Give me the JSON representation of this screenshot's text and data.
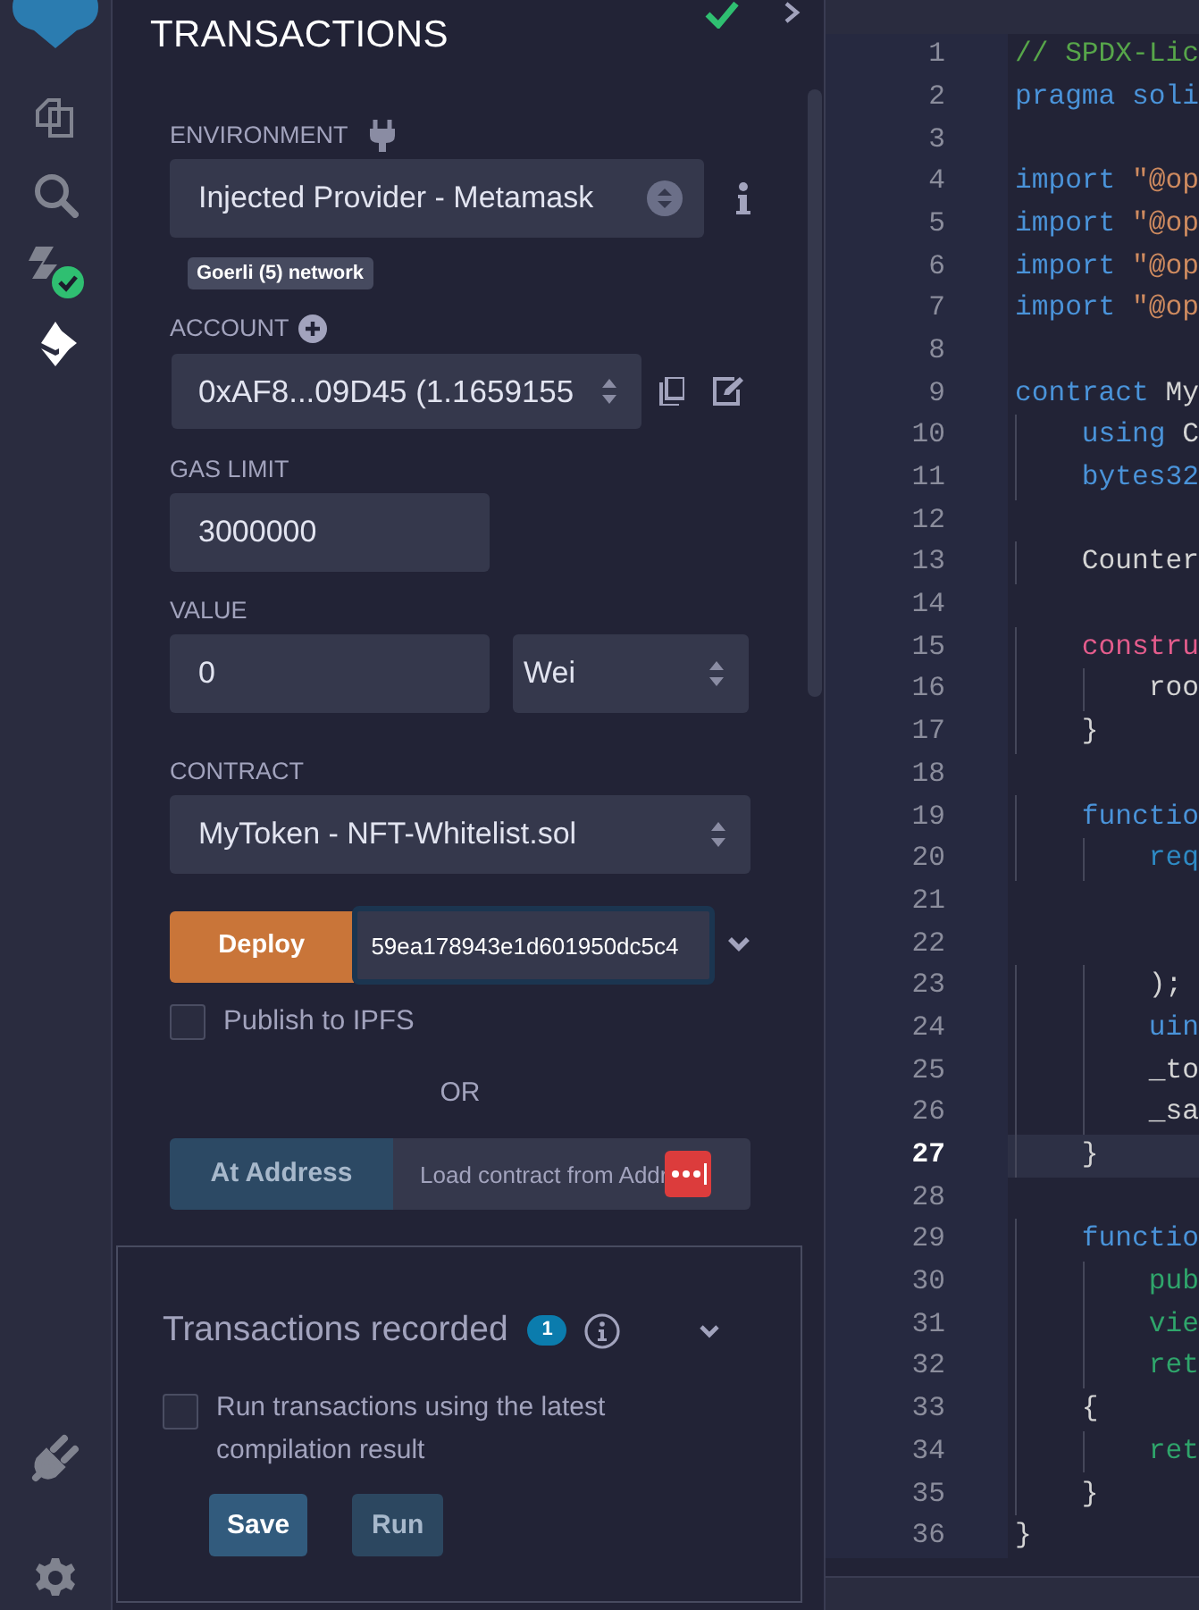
{
  "sidebar": {
    "items": [
      {
        "kind": "files",
        "selected": false
      },
      {
        "kind": "search",
        "selected": false
      },
      {
        "kind": "compiler",
        "selected": false,
        "compiled": true
      },
      {
        "kind": "deploy",
        "selected": true
      },
      {
        "kind": "plugins",
        "selected": false
      },
      {
        "kind": "settings",
        "selected": false
      }
    ]
  },
  "panel": {
    "title": "TRANSACTIONS",
    "environment": {
      "label": "ENVIRONMENT",
      "value": "Injected Provider - Metamask",
      "network": "Goerli (5) network"
    },
    "account": {
      "label": "ACCOUNT",
      "value": "0xAF8...09D45 (1.1659155"
    },
    "gas_limit": {
      "label": "GAS LIMIT",
      "value": "3000000"
    },
    "value": {
      "label": "VALUE",
      "amount": "0",
      "unit": "Wei"
    },
    "contract": {
      "label": "CONTRACT",
      "value": "MyToken - NFT-Whitelist.sol"
    },
    "deploy": {
      "button": "Deploy",
      "value": "59ea178943e1d601950dc5c4"
    },
    "publish": {
      "label": "Publish to IPFS",
      "checked": false
    },
    "separator": "OR",
    "at_address": {
      "button": "At Address",
      "placeholder": "Load contract from Addr"
    },
    "transactions": {
      "title": "Transactions recorded",
      "count": "1",
      "expanded": false,
      "option": {
        "label": "Run transactions using the latest compilation result",
        "checked": false
      },
      "buttons": [
        "Save",
        "Run"
      ]
    }
  },
  "editor": {
    "lines": [
      {
        "number": "1",
        "current": false,
        "segments": [
          {
            "text": "// SPDX-Lic",
            "kind": "comment"
          }
        ]
      },
      {
        "number": "2",
        "current": false,
        "segments": [
          {
            "text": "pragma soli",
            "kind": "keyword"
          }
        ]
      },
      {
        "number": "3",
        "current": false
      },
      {
        "number": "4",
        "current": false,
        "segments": [
          {
            "text": "import ",
            "kind": "keyword"
          },
          {
            "text": "\"@op",
            "kind": "string"
          }
        ]
      },
      {
        "number": "5",
        "current": false,
        "segments": [
          {
            "text": "import ",
            "kind": "keyword"
          },
          {
            "text": "\"@op",
            "kind": "string"
          }
        ]
      },
      {
        "number": "6",
        "current": false,
        "segments": [
          {
            "text": "import ",
            "kind": "keyword"
          },
          {
            "text": "\"@op",
            "kind": "string"
          }
        ]
      },
      {
        "number": "7",
        "current": false,
        "segments": [
          {
            "text": "import ",
            "kind": "keyword"
          },
          {
            "text": "\"@op",
            "kind": "string"
          }
        ]
      },
      {
        "number": "8",
        "current": false
      },
      {
        "number": "9",
        "current": false,
        "segments": [
          {
            "text": "contract ",
            "kind": "keyword"
          },
          {
            "text": "My",
            "kind": "plain"
          }
        ]
      },
      {
        "number": "10",
        "current": false,
        "segments": [
          {
            "text": "    using ",
            "kind": "keyword"
          },
          {
            "text": "C",
            "kind": "plain"
          }
        ]
      },
      {
        "number": "11",
        "current": false,
        "segments": [
          {
            "text": "    bytes32",
            "kind": "keyword"
          }
        ]
      },
      {
        "number": "12",
        "current": false
      },
      {
        "number": "13",
        "current": false,
        "segments": [
          {
            "text": "    Counter",
            "kind": "plain"
          }
        ]
      },
      {
        "number": "14",
        "current": false
      },
      {
        "number": "15",
        "current": false,
        "segments": [
          {
            "text": "    constru",
            "kind": "special"
          }
        ]
      },
      {
        "number": "16",
        "current": false,
        "segments": [
          {
            "text": "        roo",
            "kind": "plain"
          }
        ]
      },
      {
        "number": "17",
        "current": false,
        "segments": [
          {
            "text": "    }",
            "kind": "plain"
          }
        ]
      },
      {
        "number": "18",
        "current": false
      },
      {
        "number": "19",
        "current": false,
        "segments": [
          {
            "text": "    functio",
            "kind": "keyword"
          }
        ]
      },
      {
        "number": "20",
        "current": false,
        "segments": [
          {
            "text": "        req",
            "kind": "call"
          }
        ]
      },
      {
        "number": "21",
        "current": false
      },
      {
        "number": "22",
        "current": false
      },
      {
        "number": "23",
        "current": false,
        "segments": [
          {
            "text": "        );",
            "kind": "plain"
          }
        ]
      },
      {
        "number": "24",
        "current": false,
        "segments": [
          {
            "text": "        uin",
            "kind": "keyword"
          }
        ]
      },
      {
        "number": "25",
        "current": false,
        "segments": [
          {
            "text": "        _to",
            "kind": "plain"
          }
        ]
      },
      {
        "number": "26",
        "current": false,
        "segments": [
          {
            "text": "        _sa",
            "kind": "plain"
          }
        ]
      },
      {
        "number": "27",
        "current": true,
        "segments": [
          {
            "text": "    }",
            "kind": "plain"
          }
        ]
      },
      {
        "number": "28",
        "current": false
      },
      {
        "number": "29",
        "current": false,
        "segments": [
          {
            "text": "    functio",
            "kind": "keyword"
          }
        ]
      },
      {
        "number": "30",
        "current": false,
        "segments": [
          {
            "text": "        pub",
            "kind": "modifier"
          }
        ]
      },
      {
        "number": "31",
        "current": false,
        "segments": [
          {
            "text": "        vie",
            "kind": "modifier"
          }
        ]
      },
      {
        "number": "32",
        "current": false,
        "segments": [
          {
            "text": "        ret",
            "kind": "modifier"
          }
        ]
      },
      {
        "number": "33",
        "current": false,
        "segments": [
          {
            "text": "    {",
            "kind": "plain"
          }
        ]
      },
      {
        "number": "34",
        "current": false,
        "segments": [
          {
            "text": "        ret",
            "kind": "modifier"
          }
        ]
      },
      {
        "number": "35",
        "current": false,
        "segments": [
          {
            "text": "    }",
            "kind": "plain"
          }
        ]
      },
      {
        "number": "36",
        "current": false,
        "segments": [
          {
            "text": "}",
            "kind": "plain"
          }
        ]
      }
    ]
  }
}
